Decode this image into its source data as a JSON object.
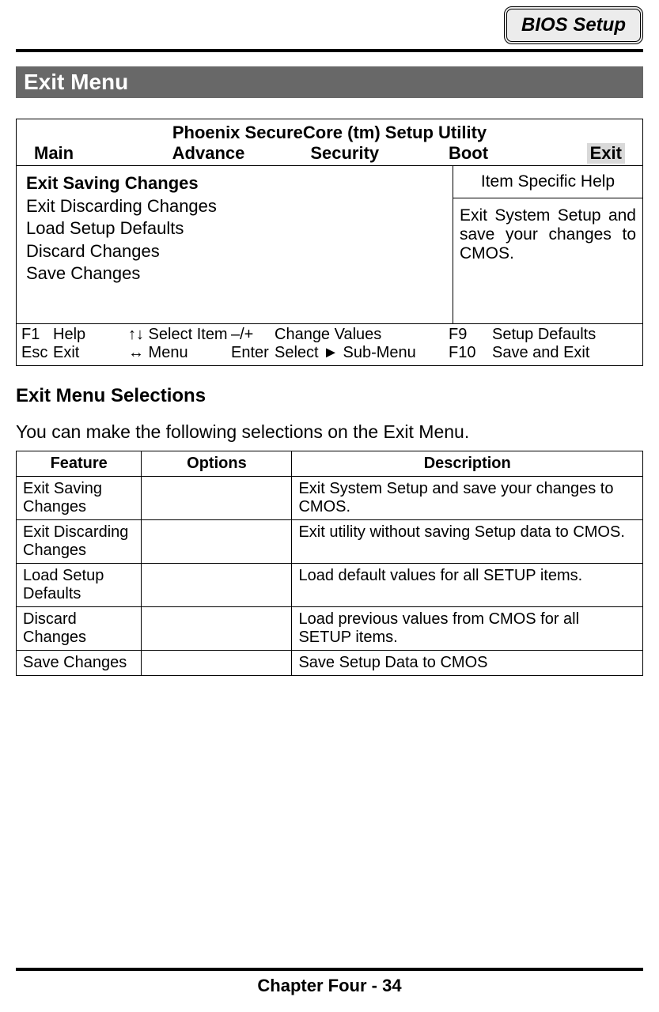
{
  "header": {
    "chip_label": "BIOS Setup"
  },
  "section": {
    "title": "Exit Menu"
  },
  "bios": {
    "utility_title": "Phoenix SecureCore (tm) Setup Utility",
    "tabs": {
      "main": "Main",
      "advance": "Advance",
      "security": "Security",
      "boot": "Boot",
      "exit": "Exit"
    },
    "menu_items": {
      "i0": "Exit Saving Changes",
      "i1": "Exit Discarding Changes",
      "i2": "Load Setup Defaults",
      "i3": "Discard Changes",
      "i4": "Save Changes"
    },
    "help": {
      "header": "Item Specific Help",
      "body": "Exit System Setup and save your changes to CMOS."
    },
    "footer": {
      "r0": {
        "k1": "F1",
        "l1": "Help",
        "arr": "↑↓ Select Item",
        "pm": "–/+",
        "cv": "Change Values",
        "k2": "F9",
        "l2": "Setup Defaults"
      },
      "r1": {
        "k1": "Esc",
        "l1": "Exit",
        "arr": "↔ Menu",
        "pm": "Enter",
        "cv": "Select ► Sub-Menu",
        "k2": "F10",
        "l2": "Save and Exit"
      }
    }
  },
  "selections": {
    "heading": "Exit Menu Selections",
    "intro": "You can make the following selections on the Exit Menu.",
    "columns": {
      "c0": "Feature",
      "c1": "Options",
      "c2": "Description"
    },
    "rows": {
      "r0": {
        "feature": "Exit Saving Changes",
        "options": "",
        "desc": "Exit System Setup and save your changes to CMOS."
      },
      "r1": {
        "feature": "Exit Discarding Changes",
        "options": "",
        "desc": "Exit utility without saving Setup data to CMOS."
      },
      "r2": {
        "feature": "Load Setup Defaults",
        "options": "",
        "desc": "Load default values for all SETUP items."
      },
      "r3": {
        "feature": "Discard Changes",
        "options": "",
        "desc": "Load previous values from CMOS for all SETUP items."
      },
      "r4": {
        "feature": "Save Changes",
        "options": "",
        "desc": "Save Setup Data to CMOS"
      }
    }
  },
  "footer": {
    "page": "Chapter Four - 34"
  }
}
